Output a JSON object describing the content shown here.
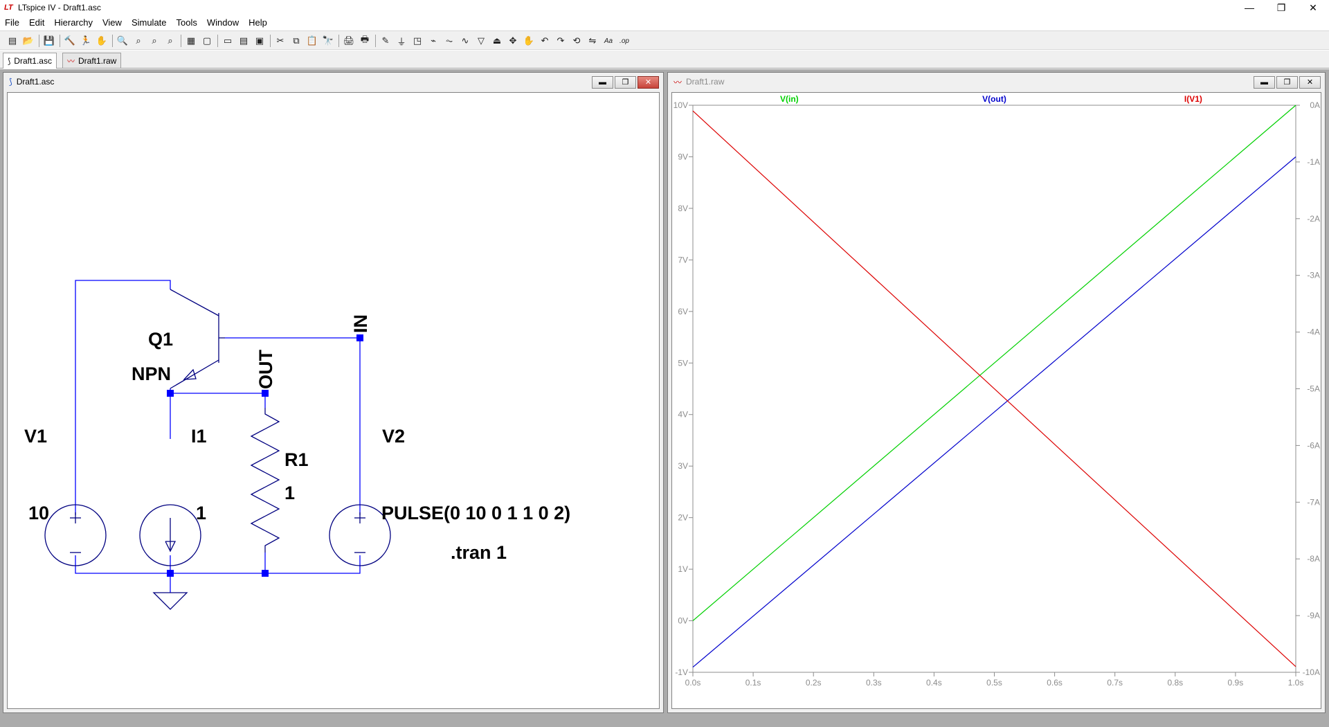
{
  "window": {
    "app_icon": "LT",
    "title": "LTspice IV - Draft1.asc",
    "minimize": "—",
    "restore": "❐",
    "close": "✕"
  },
  "menu": [
    "File",
    "Edit",
    "Hierarchy",
    "View",
    "Simulate",
    "Tools",
    "Window",
    "Help"
  ],
  "toolbar": [
    {
      "icon": "new-schematic-icon",
      "glyph": "▤"
    },
    {
      "icon": "open-icon",
      "glyph": "📂"
    },
    {
      "sep": true
    },
    {
      "icon": "save-icon",
      "glyph": "💾"
    },
    {
      "sep": true
    },
    {
      "icon": "control-panel-icon",
      "glyph": "🔨"
    },
    {
      "icon": "run-icon",
      "glyph": "🏃"
    },
    {
      "icon": "halt-icon",
      "glyph": "✋"
    },
    {
      "sep": true
    },
    {
      "icon": "zoom-in-icon",
      "glyph": "🔍"
    },
    {
      "icon": "pan-icon",
      "glyph": "⌕"
    },
    {
      "icon": "zoom-out-icon",
      "glyph": "⌕"
    },
    {
      "icon": "zoom-fit-icon",
      "glyph": "⌕"
    },
    {
      "sep": true
    },
    {
      "icon": "autorange-icon",
      "glyph": "▦"
    },
    {
      "icon": "marching-waves-icon",
      "glyph": "▢"
    },
    {
      "sep": true
    },
    {
      "icon": "tile-horizontal-icon",
      "glyph": "▭"
    },
    {
      "icon": "tile-vertical-icon",
      "glyph": "▤"
    },
    {
      "icon": "cascade-icon",
      "glyph": "▣"
    },
    {
      "sep": true
    },
    {
      "icon": "cut-icon",
      "glyph": "✂"
    },
    {
      "icon": "copy-icon",
      "glyph": "⧉"
    },
    {
      "icon": "paste-icon",
      "glyph": "📋"
    },
    {
      "icon": "find-icon",
      "glyph": "🔭"
    },
    {
      "sep": true
    },
    {
      "icon": "print-setup-icon",
      "glyph": "🖨"
    },
    {
      "icon": "print-icon",
      "glyph": "🖶"
    },
    {
      "sep": true
    },
    {
      "icon": "wire-icon",
      "glyph": "✎"
    },
    {
      "icon": "ground-icon",
      "glyph": "⏚"
    },
    {
      "icon": "label-net-icon",
      "glyph": "◳"
    },
    {
      "icon": "resistor-icon",
      "glyph": "⌁"
    },
    {
      "icon": "capacitor-icon",
      "glyph": "⏦"
    },
    {
      "icon": "inductor-icon",
      "glyph": "∿"
    },
    {
      "icon": "diode-icon",
      "glyph": "▽"
    },
    {
      "icon": "component-icon",
      "glyph": "⏏"
    },
    {
      "icon": "move-icon",
      "glyph": "✥"
    },
    {
      "icon": "drag-icon",
      "glyph": "✋"
    },
    {
      "icon": "undo-icon",
      "glyph": "↶"
    },
    {
      "icon": "redo-icon",
      "glyph": "↷"
    },
    {
      "icon": "rotate-icon",
      "glyph": "⟲"
    },
    {
      "icon": "mirror-icon",
      "glyph": "⇋"
    },
    {
      "icon": "text-icon",
      "glyph": "Aa"
    },
    {
      "icon": "spice-directive-icon",
      "glyph": ".op"
    }
  ],
  "tabs": [
    {
      "label": "Draft1.asc",
      "icon": "schematic-tab-icon",
      "glyph": "⟆"
    },
    {
      "label": "Draft1.raw",
      "icon": "waveform-tab-icon",
      "glyph": "〰"
    }
  ],
  "schematic_window": {
    "title": "Draft1.asc",
    "icon": "schematic-window-icon",
    "glyph": "⟆",
    "components": {
      "q1_name": "Q1",
      "q1_model": "NPN",
      "v1_name": "V1",
      "v1_value": "10",
      "i1_name": "I1",
      "i1_value": "1",
      "r1_name": "R1",
      "r1_value": "1",
      "v2_name": "V2",
      "v2_value": "PULSE(0 10 0 1 1 0 2)",
      "directive": ".tran 1",
      "net_in": "IN",
      "net_out": "OUT"
    },
    "colors": {
      "wire": "#0000ff",
      "symbol": "#000080",
      "junction": "#0000ff",
      "label": "#000000"
    }
  },
  "waveform_window": {
    "title": "Draft1.raw",
    "icon": "waveform-window-icon",
    "glyph": "〰"
  },
  "chart_data": {
    "type": "line",
    "x": [
      0.0,
      1.0
    ],
    "xlim": [
      0.0,
      1.0
    ],
    "x_ticks": [
      "0.0s",
      "0.1s",
      "0.2s",
      "0.3s",
      "0.4s",
      "0.5s",
      "0.6s",
      "0.7s",
      "0.8s",
      "0.9s",
      "1.0s"
    ],
    "left_axis": {
      "ylim": [
        -1,
        10
      ],
      "ticks": [
        "10V",
        "9V",
        "8V",
        "7V",
        "6V",
        "5V",
        "4V",
        "3V",
        "2V",
        "1V",
        "0V",
        "-1V"
      ]
    },
    "right_axis": {
      "ylim": [
        -10,
        0
      ],
      "ticks": [
        "0A",
        "-1A",
        "-2A",
        "-3A",
        "-4A",
        "-5A",
        "-6A",
        "-7A",
        "-8A",
        "-9A",
        "-10A"
      ]
    },
    "series": [
      {
        "name": "V(in)",
        "axis": "left",
        "color": "#00d000",
        "values": [
          0.0,
          10.0
        ]
      },
      {
        "name": "V(out)",
        "axis": "left",
        "color": "#0000cc",
        "values": [
          -0.9,
          9.0
        ]
      },
      {
        "name": "I(V1)",
        "axis": "right",
        "color": "#dd0000",
        "values": [
          -0.1,
          -9.9
        ]
      }
    ],
    "grid": false,
    "legend": "top"
  }
}
